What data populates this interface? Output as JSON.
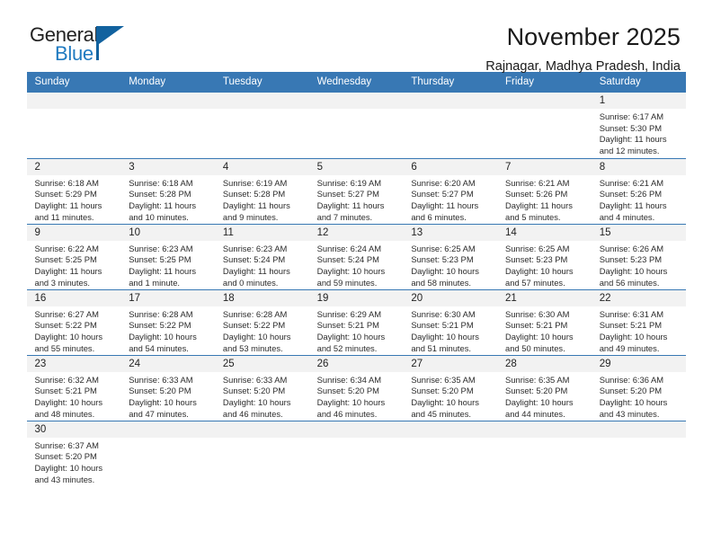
{
  "logo": {
    "text_primary": "General",
    "text_secondary": "Blue",
    "color_primary": "#222222",
    "color_secondary": "#1f7ac0",
    "flag_color": "#12629f"
  },
  "header": {
    "title": "November 2025",
    "subtitle": "Rajnagar, Madhya Pradesh, India"
  },
  "theme": {
    "header_row_bg": "#3878b4",
    "header_row_text": "#ffffff",
    "daynum_bg": "#f2f2f2",
    "grid_line": "#3878b4"
  },
  "calendar": {
    "weekday_headers": [
      "Sunday",
      "Monday",
      "Tuesday",
      "Wednesday",
      "Thursday",
      "Friday",
      "Saturday"
    ],
    "weeks": [
      [
        {
          "day": "",
          "blank": true
        },
        {
          "day": "",
          "blank": true
        },
        {
          "day": "",
          "blank": true
        },
        {
          "day": "",
          "blank": true
        },
        {
          "day": "",
          "blank": true
        },
        {
          "day": "",
          "blank": true
        },
        {
          "day": "1",
          "sunrise": "Sunrise: 6:17 AM",
          "sunset": "Sunset: 5:30 PM",
          "daylight_1": "Daylight: 11 hours",
          "daylight_2": "and 12 minutes."
        }
      ],
      [
        {
          "day": "2",
          "sunrise": "Sunrise: 6:18 AM",
          "sunset": "Sunset: 5:29 PM",
          "daylight_1": "Daylight: 11 hours",
          "daylight_2": "and 11 minutes."
        },
        {
          "day": "3",
          "sunrise": "Sunrise: 6:18 AM",
          "sunset": "Sunset: 5:28 PM",
          "daylight_1": "Daylight: 11 hours",
          "daylight_2": "and 10 minutes."
        },
        {
          "day": "4",
          "sunrise": "Sunrise: 6:19 AM",
          "sunset": "Sunset: 5:28 PM",
          "daylight_1": "Daylight: 11 hours",
          "daylight_2": "and 9 minutes."
        },
        {
          "day": "5",
          "sunrise": "Sunrise: 6:19 AM",
          "sunset": "Sunset: 5:27 PM",
          "daylight_1": "Daylight: 11 hours",
          "daylight_2": "and 7 minutes."
        },
        {
          "day": "6",
          "sunrise": "Sunrise: 6:20 AM",
          "sunset": "Sunset: 5:27 PM",
          "daylight_1": "Daylight: 11 hours",
          "daylight_2": "and 6 minutes."
        },
        {
          "day": "7",
          "sunrise": "Sunrise: 6:21 AM",
          "sunset": "Sunset: 5:26 PM",
          "daylight_1": "Daylight: 11 hours",
          "daylight_2": "and 5 minutes."
        },
        {
          "day": "8",
          "sunrise": "Sunrise: 6:21 AM",
          "sunset": "Sunset: 5:26 PM",
          "daylight_1": "Daylight: 11 hours",
          "daylight_2": "and 4 minutes."
        }
      ],
      [
        {
          "day": "9",
          "sunrise": "Sunrise: 6:22 AM",
          "sunset": "Sunset: 5:25 PM",
          "daylight_1": "Daylight: 11 hours",
          "daylight_2": "and 3 minutes."
        },
        {
          "day": "10",
          "sunrise": "Sunrise: 6:23 AM",
          "sunset": "Sunset: 5:25 PM",
          "daylight_1": "Daylight: 11 hours",
          "daylight_2": "and 1 minute."
        },
        {
          "day": "11",
          "sunrise": "Sunrise: 6:23 AM",
          "sunset": "Sunset: 5:24 PM",
          "daylight_1": "Daylight: 11 hours",
          "daylight_2": "and 0 minutes."
        },
        {
          "day": "12",
          "sunrise": "Sunrise: 6:24 AM",
          "sunset": "Sunset: 5:24 PM",
          "daylight_1": "Daylight: 10 hours",
          "daylight_2": "and 59 minutes."
        },
        {
          "day": "13",
          "sunrise": "Sunrise: 6:25 AM",
          "sunset": "Sunset: 5:23 PM",
          "daylight_1": "Daylight: 10 hours",
          "daylight_2": "and 58 minutes."
        },
        {
          "day": "14",
          "sunrise": "Sunrise: 6:25 AM",
          "sunset": "Sunset: 5:23 PM",
          "daylight_1": "Daylight: 10 hours",
          "daylight_2": "and 57 minutes."
        },
        {
          "day": "15",
          "sunrise": "Sunrise: 6:26 AM",
          "sunset": "Sunset: 5:23 PM",
          "daylight_1": "Daylight: 10 hours",
          "daylight_2": "and 56 minutes."
        }
      ],
      [
        {
          "day": "16",
          "sunrise": "Sunrise: 6:27 AM",
          "sunset": "Sunset: 5:22 PM",
          "daylight_1": "Daylight: 10 hours",
          "daylight_2": "and 55 minutes."
        },
        {
          "day": "17",
          "sunrise": "Sunrise: 6:28 AM",
          "sunset": "Sunset: 5:22 PM",
          "daylight_1": "Daylight: 10 hours",
          "daylight_2": "and 54 minutes."
        },
        {
          "day": "18",
          "sunrise": "Sunrise: 6:28 AM",
          "sunset": "Sunset: 5:22 PM",
          "daylight_1": "Daylight: 10 hours",
          "daylight_2": "and 53 minutes."
        },
        {
          "day": "19",
          "sunrise": "Sunrise: 6:29 AM",
          "sunset": "Sunset: 5:21 PM",
          "daylight_1": "Daylight: 10 hours",
          "daylight_2": "and 52 minutes."
        },
        {
          "day": "20",
          "sunrise": "Sunrise: 6:30 AM",
          "sunset": "Sunset: 5:21 PM",
          "daylight_1": "Daylight: 10 hours",
          "daylight_2": "and 51 minutes."
        },
        {
          "day": "21",
          "sunrise": "Sunrise: 6:30 AM",
          "sunset": "Sunset: 5:21 PM",
          "daylight_1": "Daylight: 10 hours",
          "daylight_2": "and 50 minutes."
        },
        {
          "day": "22",
          "sunrise": "Sunrise: 6:31 AM",
          "sunset": "Sunset: 5:21 PM",
          "daylight_1": "Daylight: 10 hours",
          "daylight_2": "and 49 minutes."
        }
      ],
      [
        {
          "day": "23",
          "sunrise": "Sunrise: 6:32 AM",
          "sunset": "Sunset: 5:21 PM",
          "daylight_1": "Daylight: 10 hours",
          "daylight_2": "and 48 minutes."
        },
        {
          "day": "24",
          "sunrise": "Sunrise: 6:33 AM",
          "sunset": "Sunset: 5:20 PM",
          "daylight_1": "Daylight: 10 hours",
          "daylight_2": "and 47 minutes."
        },
        {
          "day": "25",
          "sunrise": "Sunrise: 6:33 AM",
          "sunset": "Sunset: 5:20 PM",
          "daylight_1": "Daylight: 10 hours",
          "daylight_2": "and 46 minutes."
        },
        {
          "day": "26",
          "sunrise": "Sunrise: 6:34 AM",
          "sunset": "Sunset: 5:20 PM",
          "daylight_1": "Daylight: 10 hours",
          "daylight_2": "and 46 minutes."
        },
        {
          "day": "27",
          "sunrise": "Sunrise: 6:35 AM",
          "sunset": "Sunset: 5:20 PM",
          "daylight_1": "Daylight: 10 hours",
          "daylight_2": "and 45 minutes."
        },
        {
          "day": "28",
          "sunrise": "Sunrise: 6:35 AM",
          "sunset": "Sunset: 5:20 PM",
          "daylight_1": "Daylight: 10 hours",
          "daylight_2": "and 44 minutes."
        },
        {
          "day": "29",
          "sunrise": "Sunrise: 6:36 AM",
          "sunset": "Sunset: 5:20 PM",
          "daylight_1": "Daylight: 10 hours",
          "daylight_2": "and 43 minutes."
        }
      ],
      [
        {
          "day": "30",
          "sunrise": "Sunrise: 6:37 AM",
          "sunset": "Sunset: 5:20 PM",
          "daylight_1": "Daylight: 10 hours",
          "daylight_2": "and 43 minutes."
        },
        {
          "day": "",
          "blank": true
        },
        {
          "day": "",
          "blank": true
        },
        {
          "day": "",
          "blank": true
        },
        {
          "day": "",
          "blank": true
        },
        {
          "day": "",
          "blank": true
        },
        {
          "day": "",
          "blank": true
        }
      ]
    ]
  }
}
